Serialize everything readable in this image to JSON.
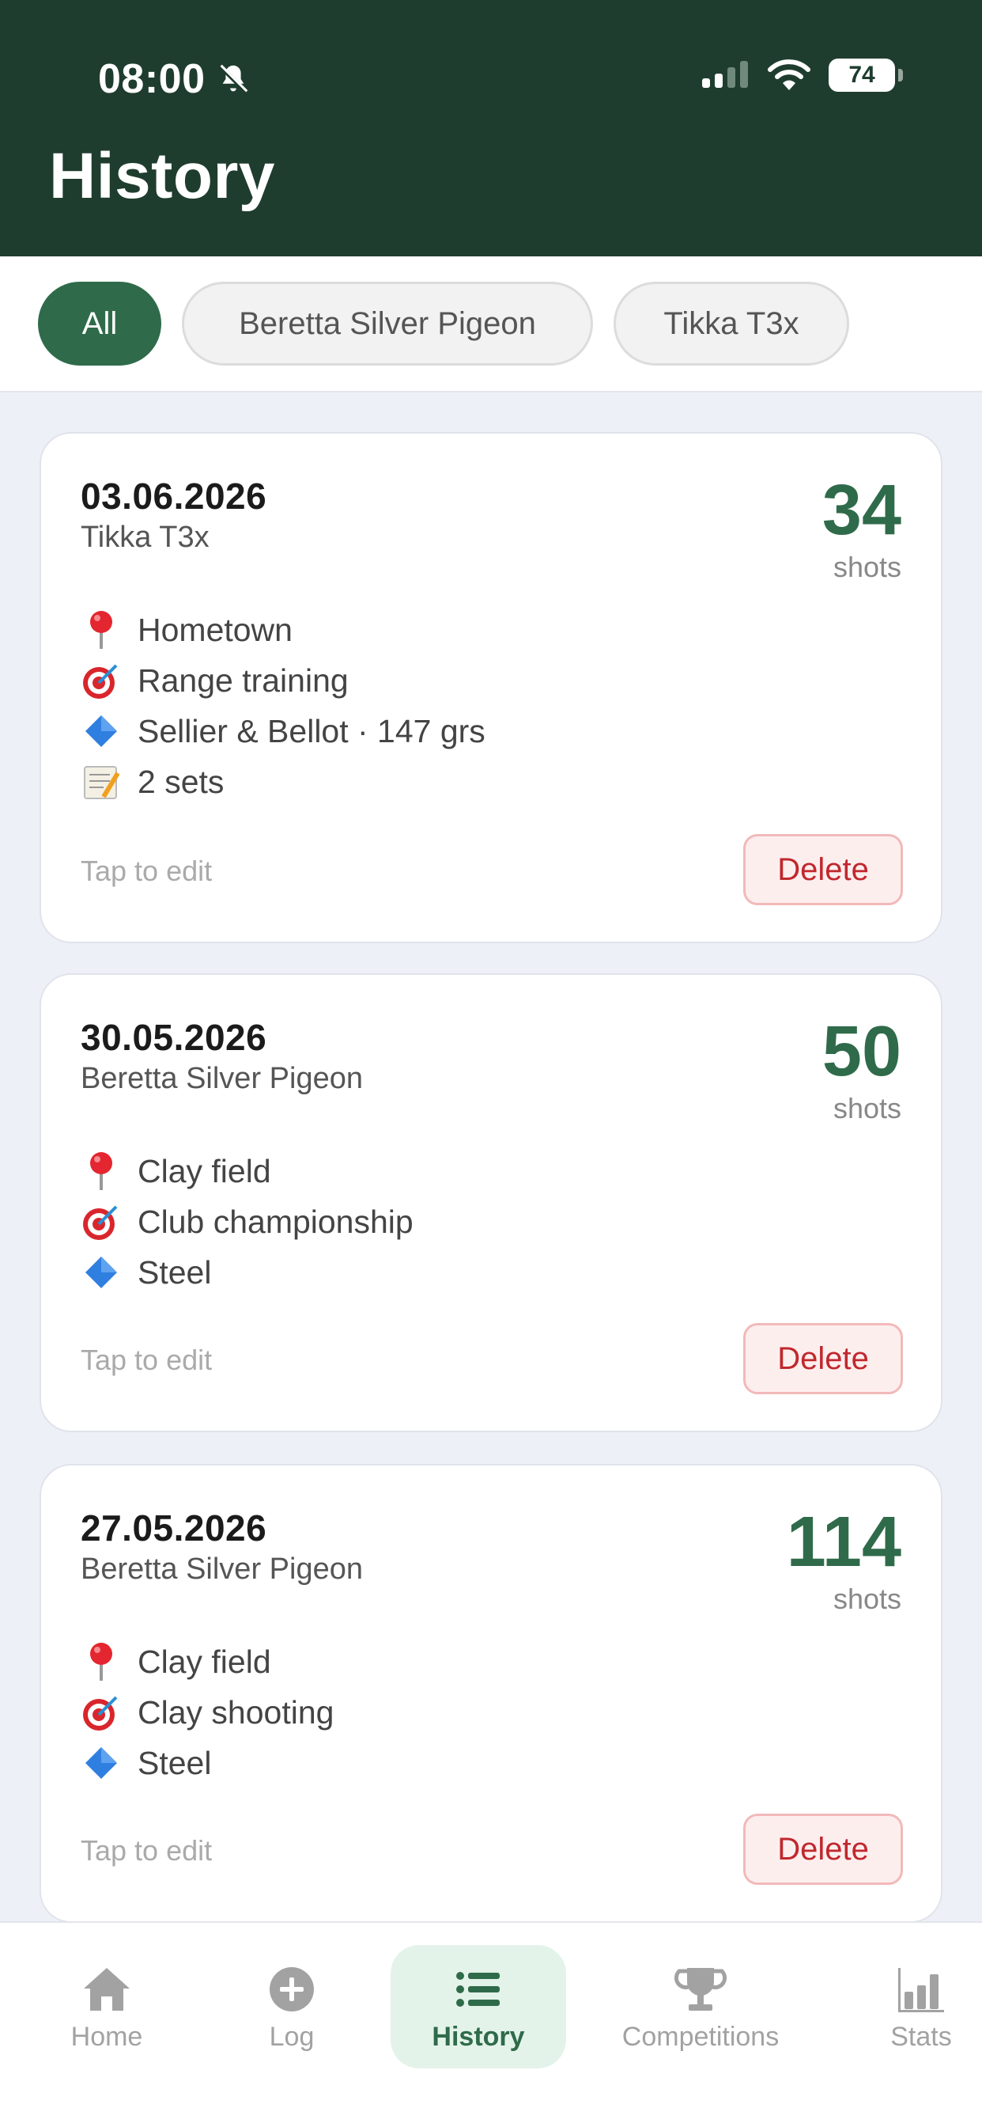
{
  "status_bar": {
    "time": "08:00",
    "battery": "74"
  },
  "header": {
    "title": "History"
  },
  "filters": [
    {
      "label": "All",
      "active": true
    },
    {
      "label": "Beretta Silver Pigeon",
      "active": false
    },
    {
      "label": "Tikka T3x",
      "active": false
    }
  ],
  "cards": [
    {
      "date": "03.06.2026",
      "gun": "Tikka T3x",
      "shots": "34",
      "shots_label": "shots",
      "location": "Hometown",
      "type": "Range training",
      "ammo": "Sellier & Bellot · 147 grs",
      "sets": "2 sets",
      "tap_hint": "Tap to edit",
      "delete_label": "Delete"
    },
    {
      "date": "30.05.2026",
      "gun": "Beretta Silver Pigeon",
      "shots": "50",
      "shots_label": "shots",
      "location": "Clay field",
      "type": "Club championship",
      "ammo": "Steel",
      "tap_hint": "Tap to edit",
      "delete_label": "Delete"
    },
    {
      "date": "27.05.2026",
      "gun": "Beretta Silver Pigeon",
      "shots": "114",
      "shots_label": "shots",
      "location": "Clay field",
      "type": "Clay shooting",
      "ammo": "Steel",
      "tap_hint": "Tap to edit",
      "delete_label": "Delete"
    }
  ],
  "nav": [
    {
      "label": "Home",
      "icon": "home-icon",
      "active": false
    },
    {
      "label": "Log",
      "icon": "plus-circle-icon",
      "active": false
    },
    {
      "label": "History",
      "icon": "list-icon",
      "active": true
    },
    {
      "label": "Competitions",
      "icon": "trophy-icon",
      "active": false
    },
    {
      "label": "Stats",
      "icon": "bar-chart-icon",
      "active": false
    }
  ],
  "colors": {
    "header_bg": "#1f3d2e",
    "accent": "#2f6b4a",
    "delete": "#c0282d"
  }
}
